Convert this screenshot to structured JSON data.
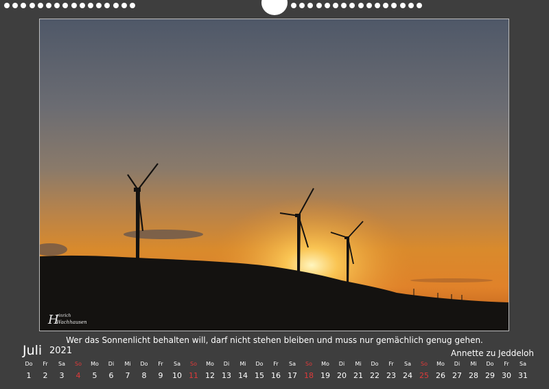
{
  "page": {
    "month": "Juli",
    "year": "2021",
    "quote": "Wer das Sonnenlicht behalten will, darf nicht stehen bleiben und muss nur gemächlich genug gehen.",
    "author": "Annette zu Jeddeloh",
    "signature": "Heinrich Wachhausen"
  },
  "colors": {
    "background": "#3e3e3e",
    "sunday": "#e03a3a",
    "text": "#ffffff"
  },
  "photo": {
    "subject": "wind-turbines-sunset"
  },
  "calendar": {
    "days": [
      {
        "wd": "Do",
        "d": "1",
        "sun": false
      },
      {
        "wd": "Fr",
        "d": "2",
        "sun": false
      },
      {
        "wd": "Sa",
        "d": "3",
        "sun": false
      },
      {
        "wd": "So",
        "d": "4",
        "sun": true
      },
      {
        "wd": "Mo",
        "d": "5",
        "sun": false
      },
      {
        "wd": "Di",
        "d": "6",
        "sun": false
      },
      {
        "wd": "Mi",
        "d": "7",
        "sun": false
      },
      {
        "wd": "Do",
        "d": "8",
        "sun": false
      },
      {
        "wd": "Fr",
        "d": "9",
        "sun": false
      },
      {
        "wd": "Sa",
        "d": "10",
        "sun": false
      },
      {
        "wd": "So",
        "d": "11",
        "sun": true
      },
      {
        "wd": "Mo",
        "d": "12",
        "sun": false
      },
      {
        "wd": "Di",
        "d": "13",
        "sun": false
      },
      {
        "wd": "Mi",
        "d": "14",
        "sun": false
      },
      {
        "wd": "Do",
        "d": "15",
        "sun": false
      },
      {
        "wd": "Fr",
        "d": "16",
        "sun": false
      },
      {
        "wd": "Sa",
        "d": "17",
        "sun": false
      },
      {
        "wd": "So",
        "d": "18",
        "sun": true
      },
      {
        "wd": "Mo",
        "d": "19",
        "sun": false
      },
      {
        "wd": "Di",
        "d": "20",
        "sun": false
      },
      {
        "wd": "Mi",
        "d": "21",
        "sun": false
      },
      {
        "wd": "Do",
        "d": "22",
        "sun": false
      },
      {
        "wd": "Fr",
        "d": "23",
        "sun": false
      },
      {
        "wd": "Sa",
        "d": "24",
        "sun": false
      },
      {
        "wd": "So",
        "d": "25",
        "sun": true
      },
      {
        "wd": "Mo",
        "d": "26",
        "sun": false
      },
      {
        "wd": "Di",
        "d": "27",
        "sun": false
      },
      {
        "wd": "Mi",
        "d": "28",
        "sun": false
      },
      {
        "wd": "Do",
        "d": "29",
        "sun": false
      },
      {
        "wd": "Fr",
        "d": "30",
        "sun": false
      },
      {
        "wd": "Sa",
        "d": "31",
        "sun": false
      }
    ]
  }
}
